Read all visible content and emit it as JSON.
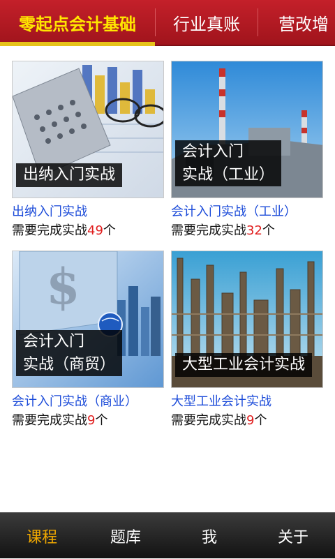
{
  "tabs": [
    {
      "label": "零起点会计基础",
      "active": true
    },
    {
      "label": "行业真账",
      "active": false
    },
    {
      "label": "营改增",
      "active": false
    }
  ],
  "courses": [
    {
      "image_caption": [
        "出纳入门实战"
      ],
      "title": "出纳入门实战",
      "sub_prefix": "需要完成实战",
      "count": "49",
      "sub_suffix": "个"
    },
    {
      "image_caption": [
        "会计入门",
        "实战（工业）"
      ],
      "title": "会计入门实战（工业）",
      "sub_prefix": "需要完成实战",
      "count": "32",
      "sub_suffix": "个"
    },
    {
      "image_caption": [
        "会计入门",
        "实战（商贸）"
      ],
      "title": "会计入门实战（商业）",
      "sub_prefix": "需要完成实战",
      "count": "9",
      "sub_suffix": "个"
    },
    {
      "image_caption": [
        "大型工业会计实战"
      ],
      "title": "大型工业会计实战",
      "sub_prefix": "需要完成实战",
      "count": "9",
      "sub_suffix": "个"
    }
  ],
  "bottom_nav": [
    {
      "label": "课程",
      "active": true
    },
    {
      "label": "题库",
      "active": false
    },
    {
      "label": "我",
      "active": false
    },
    {
      "label": "关于",
      "active": false
    }
  ],
  "colors": {
    "header": "#b81a23",
    "active_tab": "#ffe600",
    "title_link": "#1a4ad9",
    "count": "#e01d1d",
    "nav_active": "#f0a800"
  }
}
